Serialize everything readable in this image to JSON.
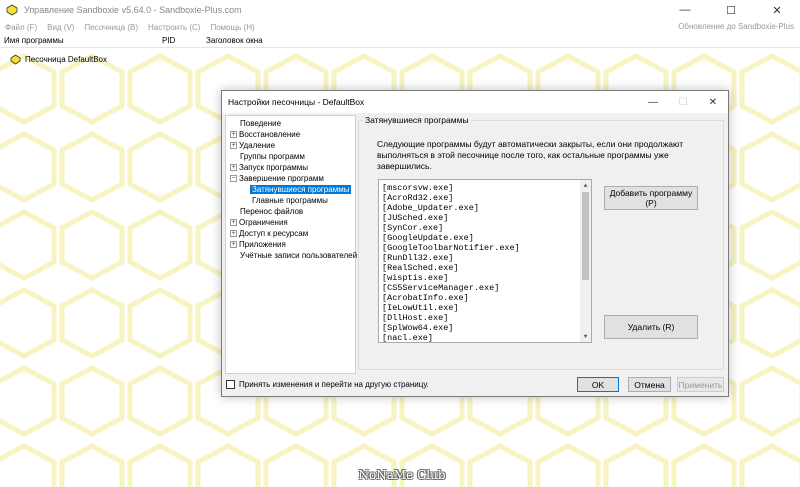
{
  "app": {
    "title": "Управление Sandboxie v5.64.0 - Sandboxie-Plus.com",
    "controls": {
      "minimize": "—",
      "maximize": "☐",
      "close": "✕"
    }
  },
  "menu": {
    "items": [
      "Файл (F)",
      "Вид (V)",
      "Песочница (B)",
      "Настроить (C)",
      "Помощь (H)"
    ],
    "right": "Обновление до Sandboxie-Plus"
  },
  "columns": {
    "program": "Имя программы",
    "pid": "PID",
    "window": "Заголовок окна"
  },
  "sandbox": {
    "label": "Песочница DefaultBox",
    "color": "#f5e030"
  },
  "watermark": "NoNaMe Club",
  "dialog": {
    "title": "Настройки песочницы - DefaultBox",
    "controls": {
      "minimize": "—",
      "maximize": "☐",
      "close": "✕"
    },
    "tree": [
      {
        "label": "Поведение",
        "level": 0,
        "expander": ""
      },
      {
        "label": "Восстановление",
        "level": 0,
        "expander": "+"
      },
      {
        "label": "Удаление",
        "level": 0,
        "expander": "+"
      },
      {
        "label": "Группы программ",
        "level": 0,
        "expander": ""
      },
      {
        "label": "Запуск программы",
        "level": 0,
        "expander": "+"
      },
      {
        "label": "Завершение программ",
        "level": 0,
        "expander": "−"
      },
      {
        "label": "Затянувшиеся программы",
        "level": 1,
        "expander": "",
        "selected": true
      },
      {
        "label": "Главные программы",
        "level": 1,
        "expander": ""
      },
      {
        "label": "Перенос файлов",
        "level": 0,
        "expander": ""
      },
      {
        "label": "Ограничения",
        "level": 0,
        "expander": "+"
      },
      {
        "label": "Доступ к ресурсам",
        "level": 0,
        "expander": "+"
      },
      {
        "label": "Приложения",
        "level": 0,
        "expander": "+"
      },
      {
        "label": "Учётные записи пользователей",
        "level": 0,
        "expander": ""
      }
    ],
    "group_title": "Затянувшиеся программы",
    "description": "Следующие программы будут автоматически закрыты, если они продолжают выполняться в этой песочнице после того, как остальные программы уже завершились.",
    "programs": [
      "[mscorsvw.exe]",
      "[AcroRd32.exe]",
      "[Adobe_Updater.exe]",
      "[JUSched.exe]",
      "[SynCor.exe]",
      "[GoogleUpdate.exe]",
      "[GoogleToolbarNotifier.exe]",
      "[RunDll32.exe]",
      "[RealSched.exe]",
      "[wisptis.exe]",
      "[CS5ServiceManager.exe]",
      "[AcrobatInfo.exe]",
      "[IeLowUtil.exe]",
      "[DllHost.exe]",
      "[SplWow64.exe]",
      "[nacl.exe]"
    ],
    "buttons": {
      "add": "Добавить программу (P)",
      "remove": "Удалить (R)",
      "ok": "OK",
      "cancel": "Отмена",
      "apply": "Применить"
    },
    "footer_checkbox": "Принять изменения и перейти на другую страницу."
  }
}
